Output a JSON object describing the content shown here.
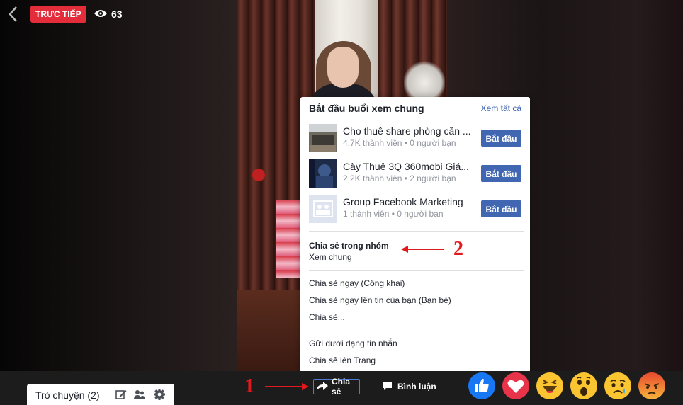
{
  "top": {
    "live_label": "TRỰC TIẾP",
    "viewer_count": "63"
  },
  "popup": {
    "title": "Bắt đầu buổi xem chung",
    "see_all": "Xem tất cả",
    "groups": [
      {
        "name": "Cho thuê share phòng căn ...",
        "meta": "4,7K thành viên • 0 người bạn",
        "button": "Bắt đầu"
      },
      {
        "name": "Cày Thuê 3Q 360mobi Giá...",
        "meta": "2,2K thành viên • 2 người bạn",
        "button": "Bắt đầu"
      },
      {
        "name": "Group Facebook Marketing",
        "meta": "1 thành viên • 0 người bạn",
        "button": "Bắt đầu"
      }
    ],
    "share_in_group": "Chia sẻ trong nhóm",
    "watch_party": "Xem chung",
    "menu": [
      "Chia sẻ ngay (Công khai)",
      "Chia sẻ ngay lên tin của bạn (Bạn bè)",
      "Chia sẻ...",
      "Gửi dưới dạng tin nhắn",
      "Chia sẻ lên Trang"
    ]
  },
  "annotations": {
    "one": "1",
    "two": "2",
    "color": "#e0191c"
  },
  "bottom": {
    "chat_label": "Trò chuyện (2)",
    "share_label": "Chia sẻ",
    "comment_label": "Bình luận",
    "reactions": [
      "like-icon",
      "love-icon",
      "haha-icon",
      "wow-icon",
      "sad-icon",
      "angry-icon"
    ]
  },
  "colors": {
    "live_red": "#e42d3b",
    "fb_blue": "#4267b2",
    "link_blue": "#4267b2"
  }
}
